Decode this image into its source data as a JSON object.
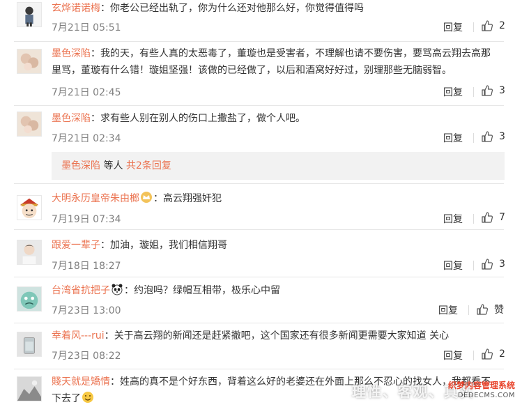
{
  "comments": [
    {
      "name": "玄烨诺诺梅",
      "sep": "：",
      "text": "你老公已经出轨了，你为什么还对他那么好，你觉得值得吗",
      "time": "7月21日 05:51",
      "reply": "回复",
      "likes": "2"
    },
    {
      "name": "墨色深陷",
      "sep": "：",
      "text": "我的天，有些人真的太恶毒了，董璇也是受害者，不理解也请不要伤害，要骂高云翔去高那里骂，董璇有什么错！璇姐坚强！该做的已经做了，以后和酒窝好好过，别理那些无脑弱智。",
      "time": "7月21日 02:45",
      "reply": "回复",
      "likes": "3"
    },
    {
      "name": "墨色深陷",
      "sep": "：",
      "text": "求有些人别在别人的伤口上撒盐了，做个人吧。",
      "time": "7月21日 02:34",
      "reply": "回复",
      "likes": "3"
    },
    {
      "name": "大明永历皇帝朱由榔",
      "sep": "：",
      "text": "高云翔强奸犯",
      "time": "7月19日 07:34",
      "reply": "回复",
      "likes": "7"
    },
    {
      "name": "跟爱一辈子",
      "sep": "：",
      "text": "加油，璇姐，我们相信翔哥",
      "time": "7月18日 18:27",
      "reply": "回复",
      "likes": "3"
    },
    {
      "name": "台湾省抗把子",
      "sep": "：",
      "text": "约泡吗？绿帽互相带，极乐心中留",
      "time": "7月23日 13:00",
      "reply": "回复",
      "likes": "赞"
    },
    {
      "name": "幸着风---rui",
      "sep": "：",
      "text": "关于高云翔的新闻还是赶紧撤吧，这个国家还有很多新闻更需要大家知道 关心",
      "time": "7月23日 08:22",
      "reply": "回复",
      "likes": "2"
    },
    {
      "name": "賤天就是矯情",
      "sep": "：",
      "text": "姓高的真不是个好东西，背着这么好的老婆还在外面上那么不忍心的找女人，我都看不下去了",
      "time": "",
      "reply": "",
      "likes": ""
    }
  ],
  "subreplies": {
    "name": "墨色深陷",
    "mid": " 等人 ",
    "more": "共2条回复"
  },
  "watermark": {
    "overlay": "理性、客观、真实",
    "brand": "织梦内容管理系统",
    "url": "DEDECMS.COM"
  },
  "colors": {
    "name": "#eb7350",
    "meta": "#808080",
    "text": "#333333",
    "subbox": "#f2f2f2"
  }
}
